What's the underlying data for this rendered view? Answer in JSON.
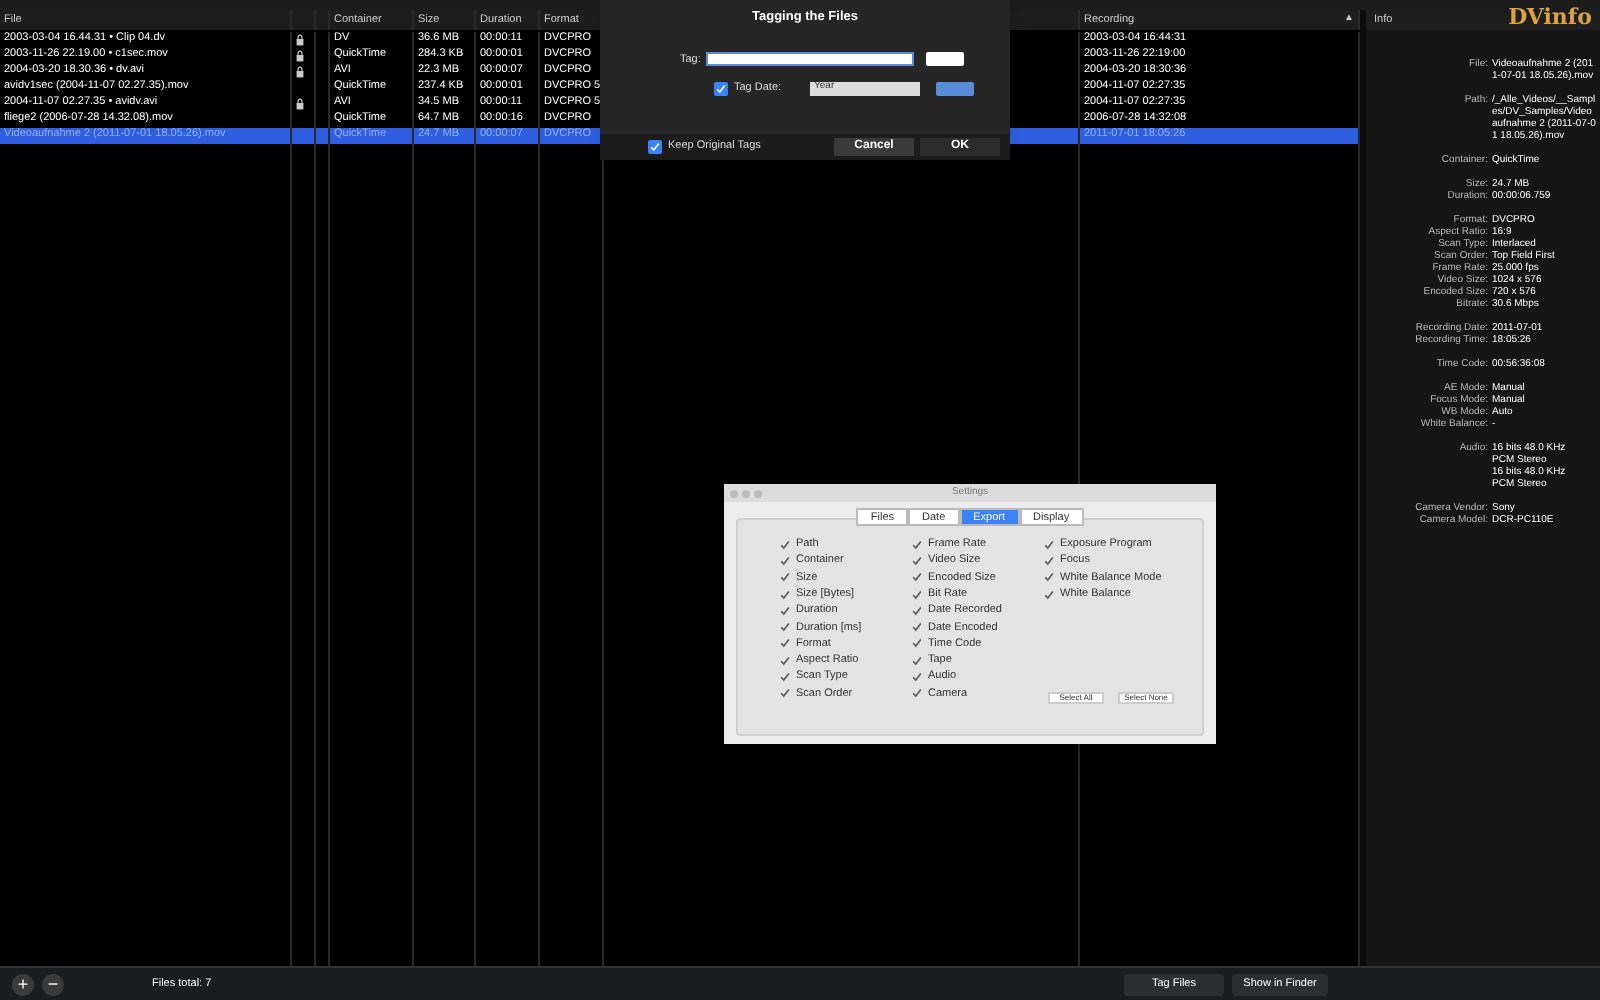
{
  "table": {
    "columns": [
      "File",
      "Container",
      "Size",
      "Duration",
      "Format",
      "Recording"
    ],
    "sort_icon": "▲",
    "rows": [
      {
        "file": "2003-03-04 16.44.31 • Clip 04.dv",
        "locked": true,
        "container": "DV",
        "size": "36.6 MB",
        "duration": "00:00:11",
        "format": "DVCPRO",
        "recording": "2003-03-04 16:44:31",
        "selected": false
      },
      {
        "file": "2003-11-26 22.19.00 • c1sec.mov",
        "locked": true,
        "container": "QuickTime",
        "size": "284.3 KB",
        "duration": "00:00:01",
        "format": "DVCPRO",
        "recording": "2003-11-26 22:19:00",
        "selected": false
      },
      {
        "file": "2004-03-20 18.30.36 • dv.avi",
        "locked": true,
        "container": "AVI",
        "size": "22.3 MB",
        "duration": "00:00:07",
        "format": "DVCPRO",
        "recording": "2004-03-20 18:30:36",
        "selected": false
      },
      {
        "file": "avidv1sec (2004-11-07 02.27.35).mov",
        "locked": false,
        "container": "QuickTime",
        "size": "237.4 KB",
        "duration": "00:00:01",
        "format": "DVCPRO 5",
        "recording": "2004-11-07 02:27:35",
        "selected": false
      },
      {
        "file": "2004-11-07 02.27.35 • avidv.avi",
        "locked": true,
        "container": "AVI",
        "size": "34.5 MB",
        "duration": "00:00:11",
        "format": "DVCPRO 5",
        "recording": "2004-11-07 02:27:35",
        "selected": false
      },
      {
        "file": "fliege2 (2006-07-28 14.32.08).mov",
        "locked": false,
        "container": "QuickTime",
        "size": "64.7 MB",
        "duration": "00:00:16",
        "format": "DVCPRO",
        "recording": "2006-07-28 14:32:08",
        "selected": false
      },
      {
        "file": "Videoaufnahme 2 (2011-07-01 18.05.26).mov",
        "locked": false,
        "container": "QuickTime",
        "size": "24.7 MB",
        "duration": "00:00:07",
        "format": "DVCPRO",
        "recording": "2011-07-01 18:05:26",
        "selected": true
      }
    ]
  },
  "tagging_sheet": {
    "title": "Tagging the Files",
    "tag_label": "Tag:",
    "tag_date": {
      "label": "Tag Date:",
      "checked": true
    },
    "period": "Year",
    "keep_original": {
      "label": "Keep Original Tags",
      "checked": true
    },
    "buttons": [
      "Cancel",
      "OK"
    ]
  },
  "info": {
    "header": "Info",
    "logo": "DVinfo",
    "groups": [
      [
        {
          "label": "File:",
          "lines": [
            "Videoaufnahme 2 (2011-07-01 18.05.26).mov"
          ]
        }
      ],
      [
        {
          "label": "Path:",
          "lines": [
            "/_Alle_Videos/__Samples/DV_Samples/Videoaufnahme 2 (2011-07-01 18.05.26).mov"
          ]
        }
      ],
      [
        {
          "label": "Container:",
          "lines": [
            "QuickTime"
          ]
        }
      ],
      [
        {
          "label": "Size:",
          "lines": [
            "24.7 MB"
          ]
        },
        {
          "label": "Duration:",
          "lines": [
            "00:00:06.759"
          ]
        }
      ],
      [
        {
          "label": "Format:",
          "lines": [
            "DVCPRO"
          ]
        },
        {
          "label": "Aspect Ratio:",
          "lines": [
            "16:9"
          ]
        },
        {
          "label": "Scan Type:",
          "lines": [
            "Interlaced"
          ]
        },
        {
          "label": "Scan Order:",
          "lines": [
            "Top Field First"
          ]
        },
        {
          "label": "Frame Rate:",
          "lines": [
            "25.000 fps"
          ]
        },
        {
          "label": "Video Size:",
          "lines": [
            "1024 x 576"
          ]
        },
        {
          "label": "Encoded Size:",
          "lines": [
            "720 x 576"
          ]
        },
        {
          "label": "Bitrate:",
          "lines": [
            "30.6 Mbps"
          ]
        }
      ],
      [
        {
          "label": "Recording Date:",
          "lines": [
            "2011-07-01"
          ]
        },
        {
          "label": "Recording Time:",
          "lines": [
            "18:05:26"
          ]
        }
      ],
      [
        {
          "label": "Time Code:",
          "lines": [
            "00:56:36:08"
          ]
        }
      ],
      [
        {
          "label": "AE Mode:",
          "lines": [
            "Manual"
          ]
        },
        {
          "label": "Focus Mode:",
          "lines": [
            "Manual"
          ]
        },
        {
          "label": "WB Mode:",
          "lines": [
            "Auto"
          ]
        },
        {
          "label": "White Balance:",
          "lines": [
            "-"
          ]
        }
      ],
      [
        {
          "label": "Audio:",
          "lines": [
            "16 bits 48.0 KHz",
            "PCM Stereo",
            "16 bits 48.0 KHz",
            "PCM Stereo"
          ]
        }
      ],
      [
        {
          "label": "Camera Vendor:",
          "lines": [
            "Sony"
          ]
        },
        {
          "label": "Camera Model:",
          "lines": [
            "DCR-PC110E"
          ]
        }
      ]
    ]
  },
  "settings": {
    "title": "Settings",
    "tabs": [
      {
        "label": "Files",
        "selected": false
      },
      {
        "label": "Date",
        "selected": false
      },
      {
        "label": "Export",
        "selected": true
      },
      {
        "label": "Display",
        "selected": false
      }
    ],
    "columns": [
      [
        {
          "label": "Path",
          "checked": true
        },
        {
          "label": "Container",
          "checked": true
        },
        {
          "label": "Size",
          "checked": true
        },
        {
          "label": "Size [Bytes]",
          "checked": true
        },
        {
          "label": "Duration",
          "checked": true
        },
        {
          "label": "Duration [ms]",
          "checked": true
        },
        {
          "label": "Format",
          "checked": true
        },
        {
          "label": "Aspect Ratio",
          "checked": true
        },
        {
          "label": "Scan Type",
          "checked": true
        },
        {
          "label": "Scan Order",
          "checked": true
        }
      ],
      [
        {
          "label": "Frame Rate",
          "checked": true
        },
        {
          "label": "Video Size",
          "checked": true
        },
        {
          "label": "Encoded Size",
          "checked": true
        },
        {
          "label": "Bit Rate",
          "checked": true
        },
        {
          "label": "Date Recorded",
          "checked": true
        },
        {
          "label": "Date Encoded",
          "checked": true
        },
        {
          "label": "Time Code",
          "checked": true
        },
        {
          "label": "Tape",
          "checked": true
        },
        {
          "label": "Audio",
          "checked": true
        },
        {
          "label": "Camera",
          "checked": true
        }
      ],
      [
        {
          "label": "Exposure Program",
          "checked": true
        },
        {
          "label": "Focus",
          "checked": true
        },
        {
          "label": "White Balance Mode",
          "checked": true
        },
        {
          "label": "White Balance",
          "checked": true
        }
      ]
    ],
    "buttons": [
      "Select All",
      "Select None"
    ]
  },
  "status_bar": {
    "add": "+",
    "remove": "−",
    "count": "Files total: 7",
    "buttons": [
      "Tag Files",
      "Show in Finder"
    ]
  }
}
